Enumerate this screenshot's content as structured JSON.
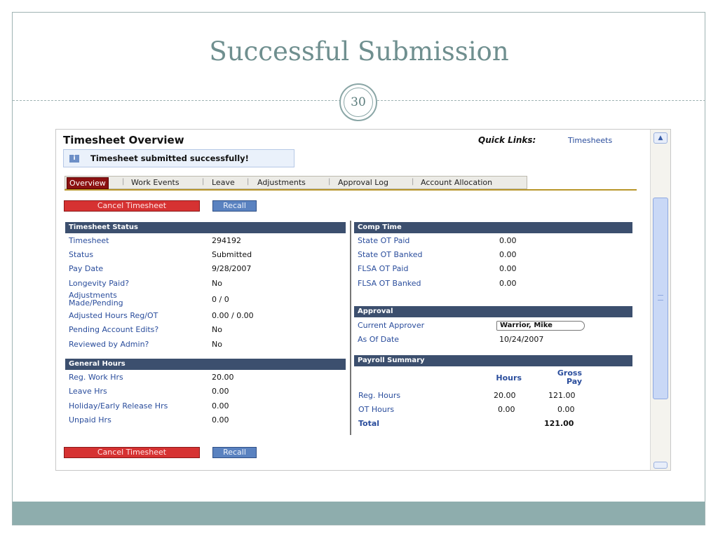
{
  "slide": {
    "title": "Successful Submission",
    "page_number": "30"
  },
  "overview": {
    "title": "Timesheet Overview",
    "quick_links_label": "Quick Links:",
    "quick_links_link": "Timesheets",
    "message": "Timesheet submitted successfully!",
    "message_icon": "i"
  },
  "tabs": [
    "Overview",
    "Work Events",
    "Leave",
    "Adjustments",
    "Approval Log",
    "Account Allocation"
  ],
  "buttons": {
    "cancel": "Cancel Timesheet",
    "recall": "Recall"
  },
  "timesheet_status": {
    "title": "Timesheet Status",
    "rows": [
      {
        "label": "Timesheet",
        "value": "294192"
      },
      {
        "label": "Status",
        "value": "Submitted"
      },
      {
        "label": "Pay Date",
        "value": "9/28/2007"
      },
      {
        "label": "Longevity Paid?",
        "value": "No"
      },
      {
        "label": "Adjustments Made/Pending",
        "value": "0 / 0"
      },
      {
        "label": "Adjusted Hours Reg/OT",
        "value": "0.00 / 0.00"
      },
      {
        "label": "Pending Account Edits?",
        "value": "No"
      },
      {
        "label": "Reviewed by Admin?",
        "value": "No"
      }
    ]
  },
  "general_hours": {
    "title": "General Hours",
    "rows": [
      {
        "label": "Reg. Work Hrs",
        "value": "20.00"
      },
      {
        "label": "Leave Hrs",
        "value": "0.00"
      },
      {
        "label": "Holiday/Early Release Hrs",
        "value": "0.00"
      },
      {
        "label": "Unpaid Hrs",
        "value": "0.00"
      }
    ]
  },
  "comp_time": {
    "title": "Comp Time",
    "rows": [
      {
        "label": "State OT Paid",
        "value": "0.00"
      },
      {
        "label": "State OT Banked",
        "value": "0.00"
      },
      {
        "label": "FLSA OT Paid",
        "value": "0.00"
      },
      {
        "label": "FLSA OT Banked",
        "value": "0.00"
      }
    ]
  },
  "approval": {
    "title": "Approval",
    "current_approver_label": "Current Approver",
    "current_approver_value": "Warrior, Mike",
    "as_of_label": "As Of Date",
    "as_of_value": "10/24/2007"
  },
  "payroll_summary": {
    "title": "Payroll Summary",
    "col_hours": "Hours",
    "col_gross": "Gross Pay",
    "rows": [
      {
        "label": "Reg. Hours",
        "hours": "20.00",
        "gross": "121.00"
      },
      {
        "label": "OT Hours",
        "hours": "0.00",
        "gross": "0.00"
      }
    ],
    "total_label": "Total",
    "total_gross": "121.00"
  },
  "colors": {
    "section_header": "#3c4f6e",
    "label_blue": "#2a4d9c",
    "cancel_red": "#d63232",
    "recall_blue": "#5a82c0",
    "active_tab": "#8b1111",
    "slide_accent": "#8eadad"
  },
  "icons": {
    "info": "info-icon",
    "scroll_up": "chevron-up-icon"
  }
}
